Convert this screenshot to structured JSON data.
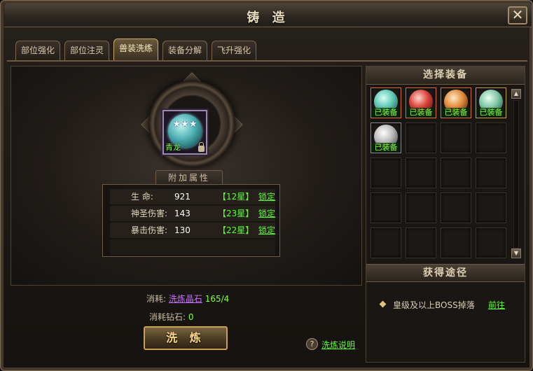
{
  "window": {
    "title": "铸 造",
    "close_glyph": "✕"
  },
  "tabs": [
    {
      "label": "部位强化",
      "active": false
    },
    {
      "label": "部位注灵",
      "active": false
    },
    {
      "label": "兽装洗练",
      "active": true
    },
    {
      "label": "装备分解",
      "active": false
    },
    {
      "label": "飞升强化",
      "active": false
    }
  ],
  "equipment": {
    "name": "青龙",
    "stars_glyph": "★★★",
    "gem_color": "#4fb0b4"
  },
  "attributes": {
    "header": "附加属性",
    "rows": [
      {
        "label": "生    命:",
        "value": "921",
        "star": "【12星】",
        "lock": "锁定"
      },
      {
        "label": "神圣伤害:",
        "value": "143",
        "star": "【23星】",
        "lock": "锁定"
      },
      {
        "label": "暴击伤害:",
        "value": "130",
        "star": "【22星】",
        "lock": "锁定"
      }
    ]
  },
  "cost": {
    "label1": "消耗:",
    "item": "洗炼晶石",
    "amount": "165/4",
    "label2": "消耗钻石:",
    "diamonds": "0"
  },
  "refine_button": "洗 炼",
  "help": {
    "icon": "?",
    "text": "洗炼说明"
  },
  "select_panel": {
    "title": "选择装备",
    "items": [
      {
        "status": "已装备",
        "color": "#5fc7b3",
        "border": "#d9723a"
      },
      {
        "status": "已装备",
        "color": "#d9423a",
        "border": "#d9723a"
      },
      {
        "status": "已装备",
        "color": "#e08a3a",
        "border": "#d9723a"
      },
      {
        "status": "已装备",
        "color": "#5fc7b3",
        "border": "#c9a04a"
      },
      {
        "status": "已装备",
        "color": "#b9b9b9",
        "border": "#8a8a8a"
      }
    ]
  },
  "source_panel": {
    "title": "获得途径",
    "text": "皇级及以上BOSS掉落",
    "link": "前往"
  }
}
